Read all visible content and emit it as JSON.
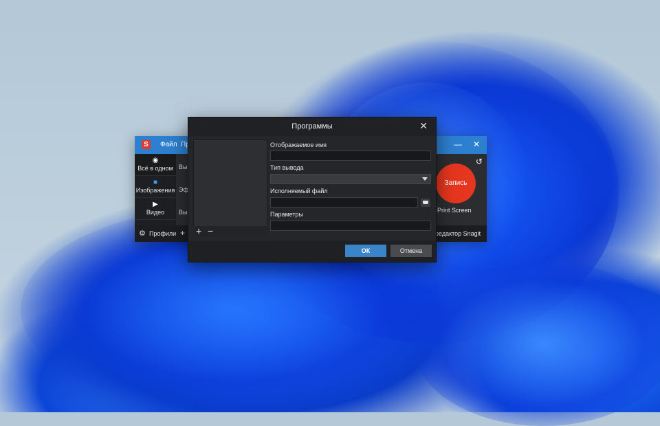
{
  "snagit": {
    "logo": "S",
    "menu": [
      "Файл",
      "Пр"
    ],
    "window_controls": [
      "—",
      "✕"
    ],
    "modes": [
      {
        "label": "Всё в одном",
        "icon": "record-dot-icon"
      },
      {
        "label": "Изображения",
        "icon": "camera-icon"
      },
      {
        "label": "Видео",
        "icon": "video-camera-icon"
      }
    ],
    "row_texts": [
      "Вы",
      "Эф",
      "Вы"
    ],
    "record_label": "Запись",
    "hotkey": "Print Screen",
    "bottom": {
      "profiles": "Профили",
      "add": "+",
      "editor": "редактор Snagit"
    },
    "refresh_icon": "↺"
  },
  "dialog": {
    "title": "Программы",
    "close": "✕",
    "fields": {
      "display_name": {
        "label": "Отображаемое имя",
        "value": ""
      },
      "output_type": {
        "label": "Тип вывода",
        "value": ""
      },
      "executable": {
        "label": "Исполняемый файл",
        "value": ""
      },
      "parameters": {
        "label": "Параметры",
        "value": ""
      }
    },
    "add": "+",
    "remove": "−",
    "ok": "ОК",
    "cancel": "Отмена"
  }
}
